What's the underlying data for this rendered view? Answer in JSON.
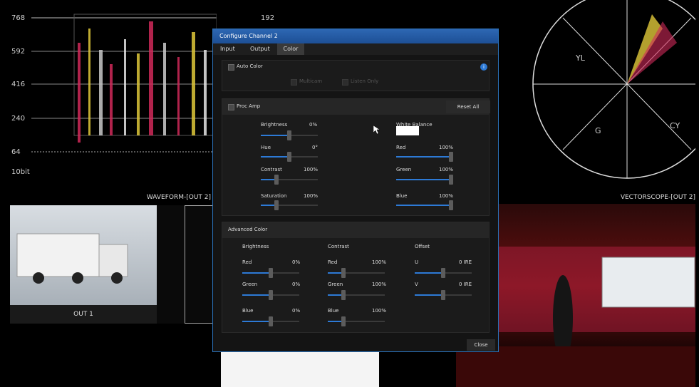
{
  "waveform": {
    "axis_labels": [
      "768",
      "592",
      "416",
      "240",
      "64",
      "10bit"
    ],
    "right_label": "192",
    "footer": "WAVEFORM-[OUT 2]"
  },
  "vectorscope": {
    "labels": [
      "YL",
      "G",
      "CY"
    ],
    "footer": "VECTORSCOPE-[OUT 2]"
  },
  "out1": {
    "label": "OUT 1"
  },
  "dialog": {
    "title": "Configure Channel 2",
    "tabs": [
      "Input",
      "Output",
      "Color"
    ],
    "active_tab": "Color",
    "auto_color": {
      "label": "Auto Color",
      "multicam": "Multicam",
      "listen_only": "Listen Only",
      "info_icon": "i"
    },
    "proc_amp": {
      "label": "Proc Amp",
      "reset_all": "Reset All",
      "brightness": {
        "label": "Brightness",
        "value": "0%",
        "level": 0.5
      },
      "hue": {
        "label": "Hue",
        "value": "0°",
        "level": 0.5
      },
      "contrast": {
        "label": "Contrast",
        "value": "100%",
        "level": 0.25
      },
      "saturation": {
        "label": "Saturation",
        "value": "100%",
        "level": 0.25
      },
      "white_balance": {
        "label": "White Balance",
        "swatch_color": "#ffffff"
      },
      "red": {
        "label": "Red",
        "value": "100%",
        "level": 1.0
      },
      "green": {
        "label": "Green",
        "value": "100%",
        "level": 1.0
      },
      "blue": {
        "label": "Blue",
        "value": "100%",
        "level": 1.0
      }
    },
    "advanced_color": {
      "label": "Advanced Color",
      "brightness": {
        "header": "Brightness",
        "red": {
          "label": "Red",
          "value": "0%",
          "level": 0.5
        },
        "green": {
          "label": "Green",
          "value": "0%",
          "level": 0.5
        },
        "blue": {
          "label": "Blue",
          "value": "0%",
          "level": 0.5
        }
      },
      "contrast": {
        "header": "Contrast",
        "red": {
          "label": "Red",
          "value": "100%",
          "level": 0.25
        },
        "green": {
          "label": "Green",
          "value": "100%",
          "level": 0.25
        },
        "blue": {
          "label": "Blue",
          "value": "100%",
          "level": 0.25
        }
      },
      "offset": {
        "header": "Offset",
        "u": {
          "label": "U",
          "value": "0 IRE",
          "level": 0.5
        },
        "v": {
          "label": "V",
          "value": "0 IRE",
          "level": 0.5
        }
      }
    },
    "close_label": "Close"
  },
  "colors": {
    "accent": "#2d7ad6",
    "title_bar": "#2d67b3"
  }
}
